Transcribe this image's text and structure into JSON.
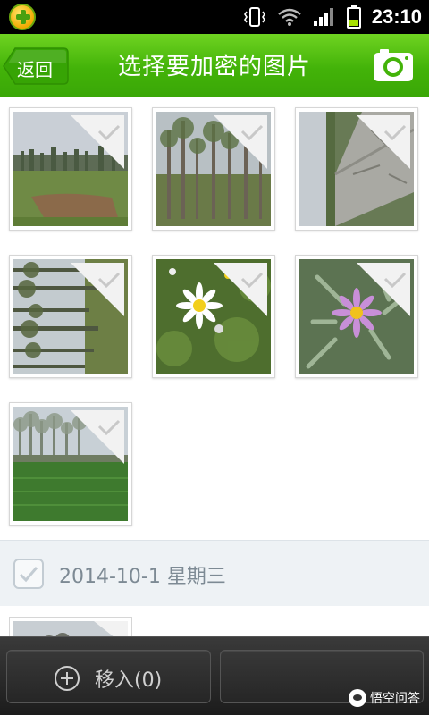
{
  "status_bar": {
    "time": "23:10",
    "icons": [
      "app-badge-icon",
      "vibrate-icon",
      "wifi-icon",
      "signal-icon",
      "battery-icon"
    ],
    "battery_color": "#a6e000"
  },
  "header": {
    "back_label": "返回",
    "title": "选择要加密的图片",
    "camera_icon": "camera-icon",
    "bar_color": "#43b309"
  },
  "photos": [
    {
      "name": "photo-field-trees",
      "scene": "field",
      "checked": false
    },
    {
      "name": "photo-poplar-grove",
      "scene": "grove",
      "checked": false
    },
    {
      "name": "photo-concrete-path",
      "scene": "path",
      "checked": false
    },
    {
      "name": "photo-rotated-trees",
      "scene": "rotated",
      "checked": false
    },
    {
      "name": "photo-white-daisies",
      "scene": "daisies",
      "checked": false
    },
    {
      "name": "photo-purple-aster",
      "scene": "aster",
      "checked": false
    },
    {
      "name": "photo-green-field",
      "scene": "greenfield",
      "checked": false
    }
  ],
  "date_group": {
    "label": "2014-10-1 星期三",
    "checked": false
  },
  "footer": {
    "move_label": "移入(0)",
    "move_icon": "plus-circle-icon",
    "second_button_label": ""
  },
  "watermark": {
    "text": "悟空问答"
  }
}
